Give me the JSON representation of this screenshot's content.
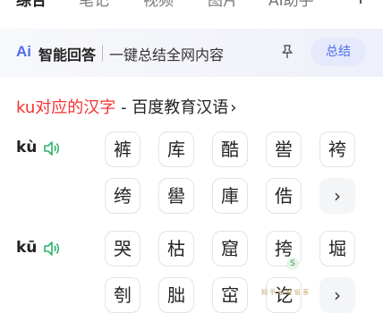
{
  "tabs": [
    {
      "label": "综合",
      "active": true
    },
    {
      "label": "笔记",
      "active": false
    },
    {
      "label": "视频",
      "active": false
    },
    {
      "label": "图片",
      "active": false
    },
    {
      "label": "AI助手",
      "active": false
    }
  ],
  "ai_bar": {
    "logo": "Ai",
    "brand": "智能回答",
    "slogan": "一键总结全网内容",
    "summary_button": "总结",
    "pin_icon": "pin-icon",
    "accent": "#4e6ef2"
  },
  "heading": {
    "red_part": "ku对应的汉字",
    "separator": " - ",
    "source": "百度教育汉语",
    "chevron": "›",
    "highlight_color": "#f73131"
  },
  "groups": [
    {
      "pinyin": "kù",
      "rows": [
        [
          "裤",
          "库",
          "酷",
          "喾",
          "袴"
        ],
        [
          "绔",
          "嚳",
          "庫",
          "俈",
          "›"
        ]
      ]
    },
    {
      "pinyin": "kū",
      "rows": [
        [
          "哭",
          "枯",
          "窟",
          "挎",
          "堀"
        ],
        [
          "刳",
          "朏",
          "窋",
          "讫",
          "›"
        ]
      ]
    }
  ],
  "watermark": "知 乎 @ 绝 俗 客"
}
